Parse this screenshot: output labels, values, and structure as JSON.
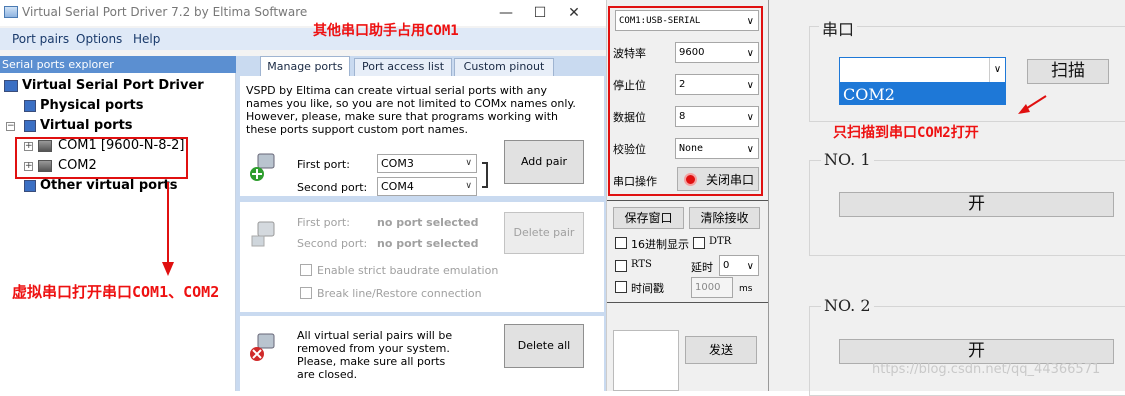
{
  "vspd": {
    "title": "Virtual Serial Port Driver 7.2 by Eltima Software",
    "window_controls": {
      "minimize": "—",
      "maximize": "☐",
      "close": "✕"
    },
    "menu": [
      "Port pairs",
      "Options",
      "Help"
    ],
    "explorer": {
      "header": "Serial ports explorer",
      "root": "Virtual Serial Port Driver",
      "physical": "Physical ports",
      "virtual": "Virtual ports",
      "ports": [
        "COM1 [9600-N-8-2]",
        "COM2"
      ],
      "other": "Other virtual ports"
    },
    "tabs": [
      "Manage ports",
      "Port access list",
      "Custom pinout"
    ],
    "intro": "VSPD by Eltima can create virtual serial ports with any names you like, so you are not limited to COMx names only. However, please, make sure that programs working with these ports support custom port names.",
    "add": {
      "first_label": "First port:",
      "first_value": "COM3",
      "second_label": "Second port:",
      "second_value": "COM4",
      "button": "Add pair"
    },
    "delete": {
      "first_label": "First port:",
      "first_value": "no port selected",
      "second_label": "Second port:",
      "second_value": "no port selected",
      "button": "Delete pair",
      "opt_strict": "Enable strict baudrate emulation",
      "opt_break": "Break line/Restore connection"
    },
    "delete_all": {
      "text": "All virtual serial pairs will be removed from your system. Please, make sure all ports are closed.",
      "button": "Delete all"
    }
  },
  "assistant": {
    "port_select": "COM1:USB-SERIAL",
    "baud_label": "波特率",
    "baud_value": "9600",
    "stop_label": "停止位",
    "stop_value": "2",
    "data_label": "数据位",
    "data_value": "8",
    "parity_label": "校验位",
    "parity_value": "None",
    "op_label": "串口操作",
    "close_button": "关闭串口",
    "save_button": "保存窗口",
    "clear_button": "清除接收",
    "hex_label": "16进制显示",
    "dtr_label": "DTR",
    "rts_label": "RTS",
    "delay_label": "延时",
    "delay_value": "0",
    "timestamp_label": "时间戳",
    "timestamp_value": "1000",
    "ms_label": "ms",
    "send_button": "发送"
  },
  "right_app": {
    "group_title": "串口",
    "combo_value": "",
    "dropdown_option": "COM2",
    "scan_button": "扫描",
    "no1_label": "NO. 1",
    "open1_button": "开",
    "no2_label": "NO. 2",
    "open2_button": "开"
  },
  "annotations": {
    "top": "其他串口助手占用COM1",
    "right": "只扫描到串口COM2打开",
    "left": "虚拟串口打开串口COM1、COM2"
  },
  "watermark": "https://blog.csdn.net/qq_44366571",
  "colors": {
    "annotation": "#ee1111",
    "explorer_header": "#5b8fd1",
    "menubar": "#dfe9f7",
    "panel": "#c9daf0",
    "dropdown_highlight": "#1e78d7"
  }
}
